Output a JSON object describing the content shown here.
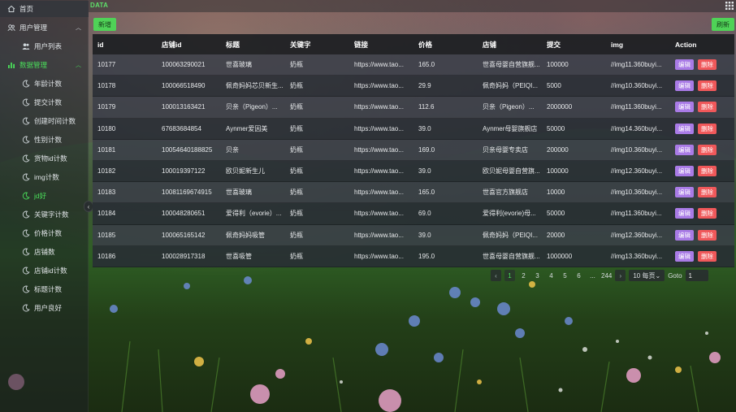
{
  "sidebar": {
    "home": "首页",
    "user_mgmt": "用户管理",
    "user_list": "用户列表",
    "data_mgmt": "数据管理",
    "items": [
      "年龄计数",
      "提交计数",
      "创建时间计数",
      "性别计数",
      "货物id计数",
      "img计数",
      "jd好",
      "关键字计数",
      "价格计数",
      "店铺数",
      "店铺id计数",
      "标题计数",
      "用户良好"
    ],
    "active_item": "jd好"
  },
  "topbar": {
    "title": "DATA"
  },
  "toolbar": {
    "add_label": "新增",
    "refresh_label": "刷新"
  },
  "table": {
    "headers": [
      "id",
      "店铺id",
      "标题",
      "关键字",
      "链接",
      "价格",
      "店铺",
      "提交",
      "img",
      "Action"
    ],
    "rows": [
      [
        "10177",
        "100063290021",
        "世喜玻璃",
        "奶瓶",
        "https://www.tao...",
        "165.0",
        "世喜母婴自营旗舰...",
        "100000",
        "//img11.360buyi..."
      ],
      [
        "10178",
        "100066518490",
        "佩奇妈妈芯贝新生...",
        "奶瓶",
        "https://www.tao...",
        "29.9",
        "佩奇妈妈（PEIQI...",
        "5000",
        "//img10.360buyi..."
      ],
      [
        "10179",
        "100013163421",
        "贝亲（Pigeon）...",
        "奶瓶",
        "https://www.tao...",
        "112.6",
        "贝亲（Pigeon）...",
        "2000000",
        "//img11.360buyi..."
      ],
      [
        "10180",
        "67683684854",
        "Aynmer爱因美",
        "奶瓶",
        "https://www.tao...",
        "39.0",
        "Aynmer母婴旗舰店",
        "50000",
        "//img14.360buyi..."
      ],
      [
        "10181",
        "10054640188825",
        "贝亲",
        "奶瓶",
        "https://www.tao...",
        "169.0",
        "贝亲母婴专卖店",
        "200000",
        "//img10.360buyi..."
      ],
      [
        "10182",
        "100019397122",
        "欧贝妮新生儿",
        "奶瓶",
        "https://www.tao...",
        "39.0",
        "欧贝妮母婴自营旗...",
        "100000",
        "//img12.360buyi..."
      ],
      [
        "10183",
        "10081169674915",
        "世喜玻璃",
        "奶瓶",
        "https://www.tao...",
        "165.0",
        "世喜官方旗舰店",
        "10000",
        "//img10.360buyi..."
      ],
      [
        "10184",
        "100048280651",
        "爱得利（evorie）...",
        "奶瓶",
        "https://www.tao...",
        "69.0",
        "爱得利(evorie)母...",
        "50000",
        "//img11.360buyi..."
      ],
      [
        "10185",
        "100065165142",
        "佩奇妈妈吸管",
        "奶瓶",
        "https://www.tao...",
        "39.0",
        "佩奇妈妈（PEIQI...",
        "20000",
        "//img12.360buyi..."
      ],
      [
        "10186",
        "100028917318",
        "世喜吸管",
        "奶瓶",
        "https://www.tao...",
        "195.0",
        "世喜母婴自营旗舰...",
        "1000000",
        "//img13.360buyi..."
      ]
    ],
    "edit_label": "编辑",
    "delete_label": "删除"
  },
  "pagination": {
    "pages": [
      "1",
      "2",
      "3",
      "4",
      "5",
      "6",
      "...",
      "244"
    ],
    "current": "1",
    "page_size": "10 每页",
    "goto_label": "Goto",
    "goto_value": "1"
  },
  "colors": {
    "accent": "#4ade5a",
    "edit": "#a97be6",
    "delete": "#f0585a"
  }
}
